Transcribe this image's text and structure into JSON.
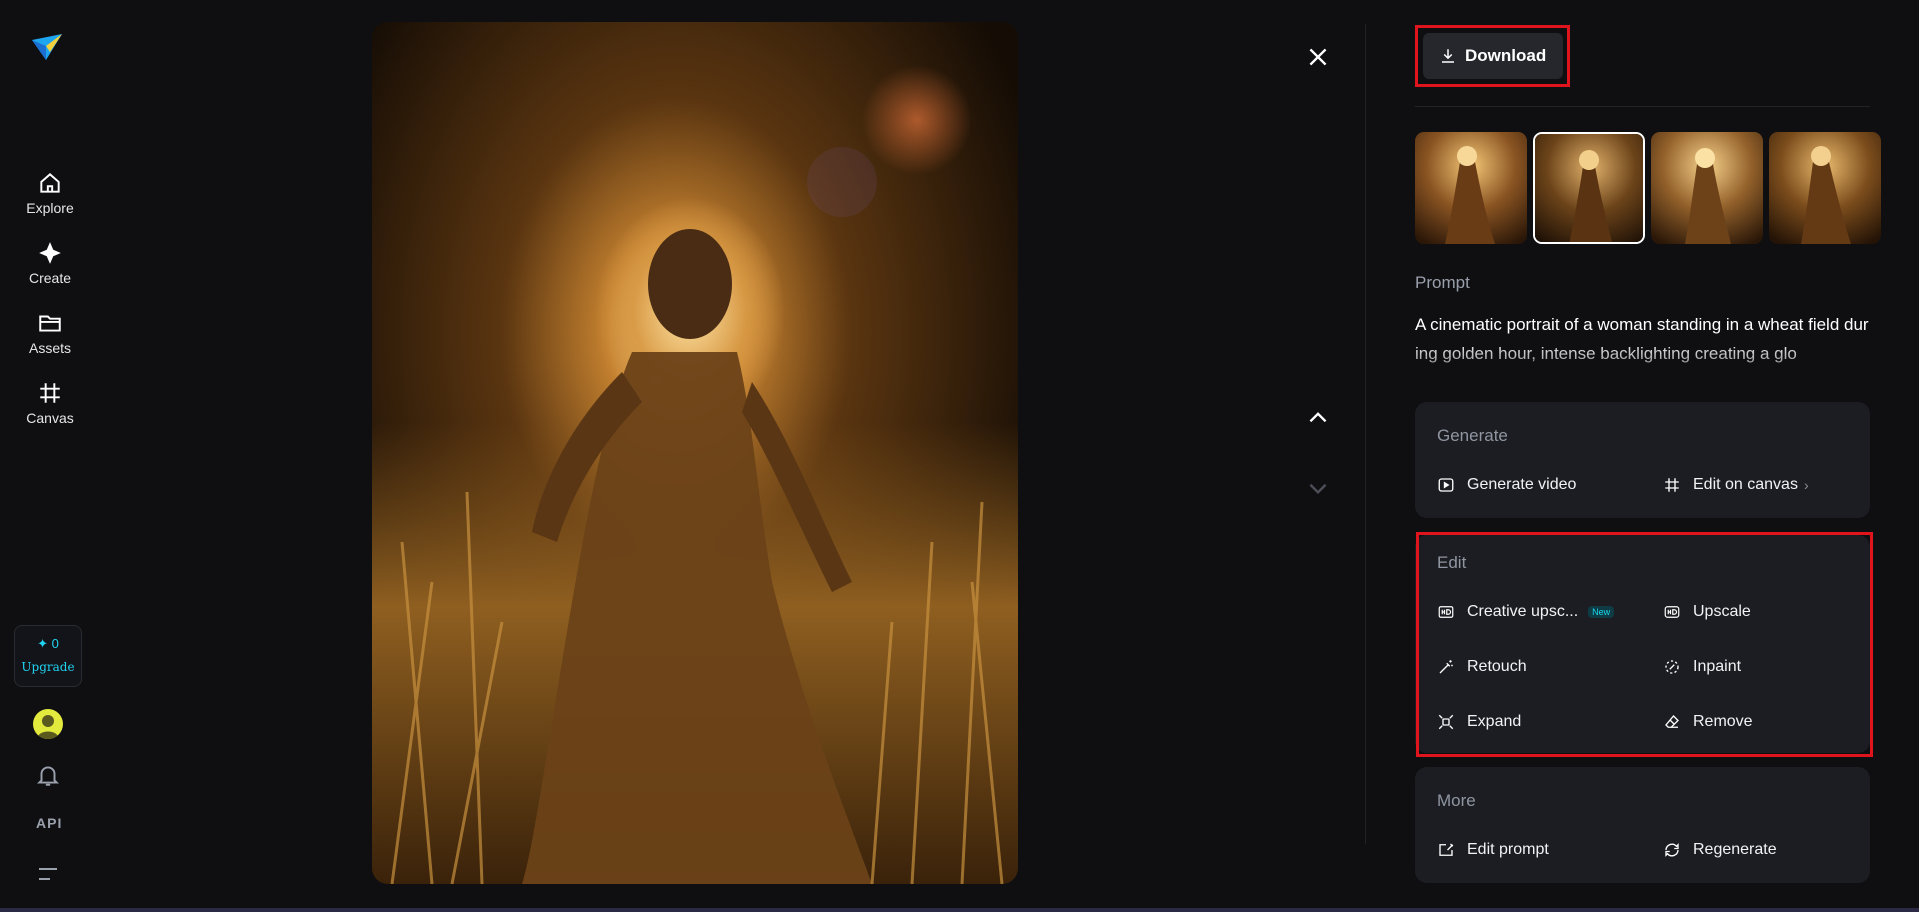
{
  "sidebar": {
    "items": [
      {
        "label": "Explore",
        "icon": "home-icon"
      },
      {
        "label": "Create",
        "icon": "sparkle-icon"
      },
      {
        "label": "Assets",
        "icon": "folder-icon"
      },
      {
        "label": "Canvas",
        "icon": "canvas-grid-icon"
      }
    ],
    "upgrade": {
      "credits": "✦ 0",
      "label": "Upgrade"
    },
    "api_label": "API"
  },
  "toolbar": {
    "download_label": "Download"
  },
  "prompt": {
    "label": "Prompt",
    "text": "A cinematic portrait of a woman standing in a wheat field during golden hour, intense backlighting creating a glo"
  },
  "generate": {
    "title": "Generate",
    "generate_video": "Generate video",
    "edit_on_canvas": "Edit on canvas"
  },
  "edit": {
    "title": "Edit",
    "creative_upscale": "Creative upsc...",
    "new_badge": "New",
    "upscale": "Upscale",
    "retouch": "Retouch",
    "inpaint": "Inpaint",
    "expand": "Expand",
    "remove": "Remove"
  },
  "more": {
    "title": "More",
    "edit_prompt": "Edit prompt",
    "regenerate": "Regenerate"
  },
  "colors": {
    "accent": "#21d4f2",
    "highlight_red": "#e0141d",
    "background": "#0f0f12",
    "card": "#1c1d22"
  }
}
